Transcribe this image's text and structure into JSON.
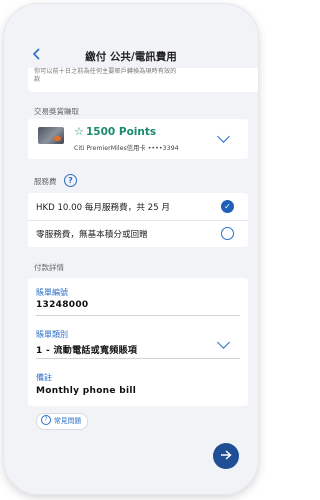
{
  "header": {
    "title": "繳付 公共/電訊費用",
    "back_icon": "chevron-left-icon"
  },
  "truncated_note": {
    "line1": "你可以前十日之前為任何主要賬戶轉換為現時有效的",
    "line2": "款"
  },
  "rewards": {
    "section_label": "交易獎賞賺取",
    "points_text": "1500 Points",
    "card_name": "Citi PremierMiles信用卡 ••••3394",
    "star_icon": "star-outline-icon"
  },
  "service_fee": {
    "section_label": "服務費",
    "options": [
      {
        "label": "HKD 10.00 每月服務費，共 25 月",
        "selected": true
      },
      {
        "label": "零服務費，無基本積分或回贈",
        "selected": false
      }
    ]
  },
  "payment_details": {
    "section_label": "付款詳情",
    "bill_number_label": "賬單編號",
    "bill_number_value": "13248000",
    "bill_type_label": "賬單類別",
    "bill_type_value": "1 - 流動電話或寬頻賬項",
    "remark_label": "備註",
    "remark_value": "Monthly phone bill"
  },
  "faq": {
    "label": "常見問題"
  },
  "next_button": {
    "icon": "arrow-right-icon"
  },
  "colors": {
    "accent": "#2a6fc9",
    "points_green": "#1a8b6b",
    "button_navy": "#1f4e95"
  }
}
